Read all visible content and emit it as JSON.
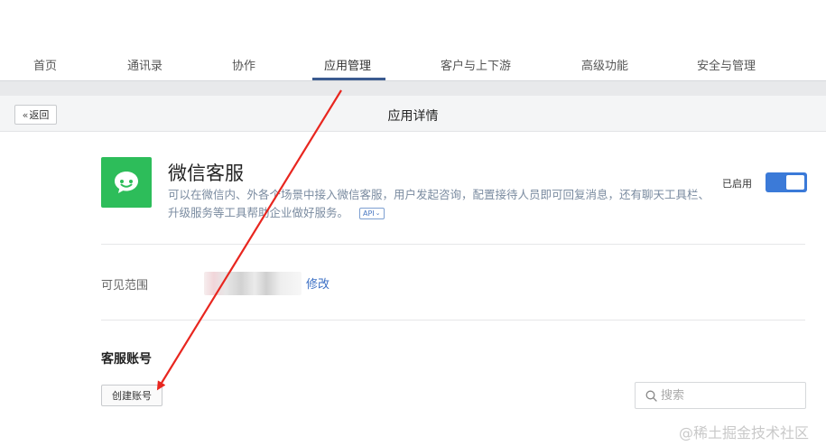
{
  "nav": {
    "items": [
      {
        "label": "首页"
      },
      {
        "label": "通讯录"
      },
      {
        "label": "协作"
      },
      {
        "label": "应用管理"
      },
      {
        "label": "客户与上下游"
      },
      {
        "label": "高级功能"
      },
      {
        "label": "安全与管理"
      }
    ],
    "active": "应用管理"
  },
  "header": {
    "back_label": "返回",
    "title": "应用详情"
  },
  "app": {
    "name": "微信客服",
    "description": "可以在微信内、外各个场景中接入微信客服，用户发起咨询，配置接待人员即可回复消息，还有聊天工具栏、升级服务等工具帮助企业做好服务。",
    "api_tag": "API",
    "status_label": "已启用",
    "enabled": true,
    "icon": "chat-bubble-icon",
    "icon_color": "#2dbd5a"
  },
  "scope": {
    "label": "可见范围",
    "modify_label": "修改"
  },
  "accounts": {
    "section_title": "客服账号",
    "create_label": "创建账号",
    "search_placeholder": "搜索"
  },
  "watermark": "@稀土掘金技术社区",
  "colors": {
    "accent": "#3b7ad8",
    "nav_underline": "#3a5a8f",
    "link": "#3b6fc4",
    "annotation_arrow": "#e8261f"
  }
}
